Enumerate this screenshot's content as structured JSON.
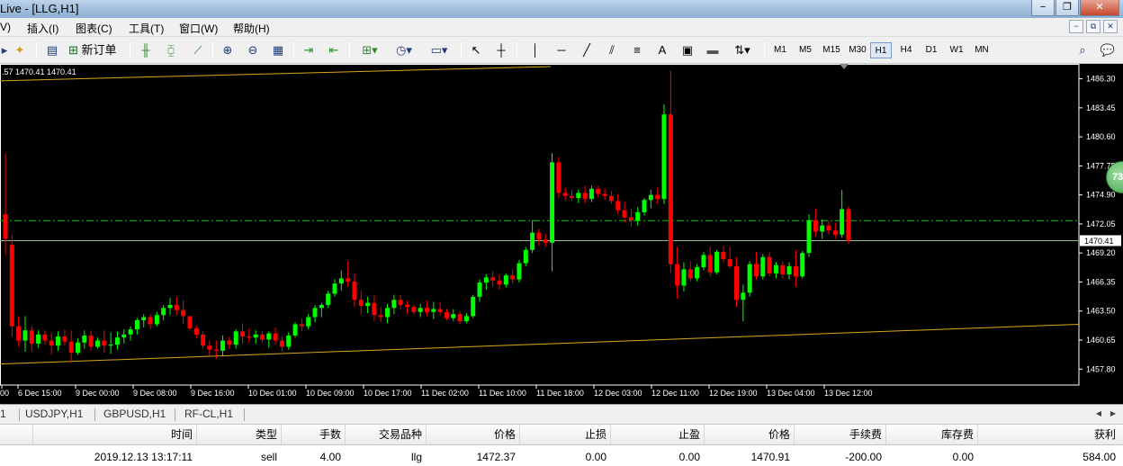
{
  "window": {
    "title": "Live - [LLG,H1]",
    "controls": [
      "−",
      "❐",
      "✕"
    ]
  },
  "menu": {
    "items": [
      "V)",
      "插入(I)",
      "图表(C)",
      "工具(T)",
      "窗口(W)",
      "帮助(H)"
    ],
    "mdi_controls": [
      "−",
      "⧉",
      "✕"
    ]
  },
  "toolbar": {
    "new_order_label": "新订单",
    "text_tool_label": "A",
    "timeframes": [
      "M1",
      "M5",
      "M15",
      "M30",
      "H1",
      "H4",
      "D1",
      "W1",
      "MN"
    ],
    "active_timeframe": "H1"
  },
  "chart": {
    "ohlc_text": ".57 1470.41 1470.41",
    "symbol": "LLG",
    "period": "H1",
    "current_price_label": "1470.41",
    "badge_text": "73",
    "colors": {
      "background": "#000000",
      "bull": "#00ff00",
      "bear": "#ff0000",
      "trendline": "#daa520",
      "price_line": "#8fbc8f",
      "order_line": "#00cc00",
      "axis_text": "#ffffff"
    }
  },
  "chart_data": {
    "type": "candlestick",
    "y_axis_labels": [
      "1486.30",
      "1483.45",
      "1480.60",
      "1477.75",
      "1474.90",
      "1472.05",
      "1469.20",
      "1466.35",
      "1463.50",
      "1460.65",
      "1457.80"
    ],
    "x_axis_labels": [
      "00",
      "6 Dec 15:00",
      "9 Dec 00:00",
      "9 Dec 08:00",
      "9 Dec 16:00",
      "10 Dec 01:00",
      "10 Dec 09:00",
      "10 Dec 17:00",
      "11 Dec 02:00",
      "11 Dec 10:00",
      "11 Dec 18:00",
      "12 Dec 03:00",
      "12 Dec 11:00",
      "12 Dec 19:00",
      "13 Dec 04:00",
      "13 Dec 12:00"
    ],
    "ylim": [
      1456.5,
      1487.5
    ],
    "current_price": 1470.41,
    "order_price": 1472.37,
    "candles": [
      [
        1473,
        1479,
        1469,
        1470.6
      ],
      [
        1470,
        1471,
        1461,
        1462
      ],
      [
        1462,
        1463,
        1460,
        1460.6
      ],
      [
        1460.6,
        1463,
        1459.5,
        1461.6
      ],
      [
        1461.6,
        1462,
        1459.5,
        1460.3
      ],
      [
        1460.3,
        1461.6,
        1459.9,
        1461.2
      ],
      [
        1461.2,
        1461.6,
        1460.2,
        1460.6
      ],
      [
        1460.6,
        1461.4,
        1459.2,
        1460.1
      ],
      [
        1460.1,
        1461.5,
        1459.6,
        1461
      ],
      [
        1461,
        1461.7,
        1460.1,
        1460.5
      ],
      [
        1460.5,
        1461.6,
        1458.4,
        1459.4
      ],
      [
        1459.4,
        1460.8,
        1459.2,
        1460.4
      ],
      [
        1460.4,
        1461.6,
        1459.8,
        1461.1
      ],
      [
        1461.1,
        1461.6,
        1459.6,
        1460
      ],
      [
        1460,
        1460.9,
        1459.8,
        1460.6
      ],
      [
        1460.6,
        1461.6,
        1459.4,
        1460.1
      ],
      [
        1460.1,
        1461.4,
        1459.3,
        1460.2
      ],
      [
        1460.2,
        1461.5,
        1459.7,
        1460.9
      ],
      [
        1460.9,
        1461.7,
        1460.3,
        1461.2
      ],
      [
        1461.2,
        1462,
        1460.6,
        1461.7
      ],
      [
        1461.7,
        1462.8,
        1461.2,
        1462.6
      ],
      [
        1462.6,
        1463.2,
        1461.9,
        1462.9
      ],
      [
        1462.9,
        1463.2,
        1461.7,
        1462.2
      ],
      [
        1462.2,
        1463.4,
        1462,
        1463.1
      ],
      [
        1463.1,
        1464.1,
        1462.6,
        1463.8
      ],
      [
        1463.8,
        1464.8,
        1463.1,
        1464.1
      ],
      [
        1464.1,
        1464.9,
        1463.1,
        1463.6
      ],
      [
        1463.6,
        1464.6,
        1462.2,
        1463
      ],
      [
        1463,
        1462.8,
        1461.7,
        1461.8
      ],
      [
        1461.8,
        1462.1,
        1460.8,
        1461.2
      ],
      [
        1461.2,
        1461.5,
        1459.8,
        1460.1
      ],
      [
        1460.1,
        1460.6,
        1459.1,
        1459.7
      ],
      [
        1459.7,
        1460.6,
        1458.8,
        1459.6
      ],
      [
        1459.6,
        1461.1,
        1459.1,
        1460.6
      ],
      [
        1460.6,
        1461,
        1459.8,
        1460.2
      ],
      [
        1460.2,
        1461.7,
        1459.8,
        1461.5
      ],
      [
        1461.5,
        1462.3,
        1460.3,
        1461
      ],
      [
        1461,
        1461.8,
        1460.4,
        1460.9
      ],
      [
        1460.9,
        1461.6,
        1460.3,
        1461.2
      ],
      [
        1461.2,
        1461.5,
        1460.4,
        1460.7
      ],
      [
        1460.7,
        1461.5,
        1459.9,
        1461.3
      ],
      [
        1461.3,
        1461.9,
        1460.2,
        1460.6
      ],
      [
        1460.6,
        1461,
        1459.5,
        1460
      ],
      [
        1460,
        1461.4,
        1459.7,
        1461.1
      ],
      [
        1461.1,
        1462.4,
        1460.9,
        1462.2
      ],
      [
        1462.2,
        1462.8,
        1461.5,
        1462
      ],
      [
        1462,
        1463.2,
        1461.7,
        1462.9
      ],
      [
        1462.9,
        1464.1,
        1462.4,
        1463.8
      ],
      [
        1463.8,
        1464.3,
        1462.9,
        1464.1
      ],
      [
        1464.1,
        1465.5,
        1463.8,
        1465.2
      ],
      [
        1465.2,
        1466.6,
        1464.9,
        1466.2
      ],
      [
        1466.2,
        1467.5,
        1465.5,
        1466.7
      ],
      [
        1466.7,
        1468.4,
        1465.9,
        1466.4
      ],
      [
        1466.4,
        1467.2,
        1463.9,
        1464.6
      ],
      [
        1464.6,
        1465.5,
        1463.2,
        1464
      ],
      [
        1464,
        1464.9,
        1463.3,
        1464.3
      ],
      [
        1464.3,
        1465.1,
        1462.5,
        1463.1
      ],
      [
        1463.1,
        1463.9,
        1462.4,
        1462.9
      ],
      [
        1462.9,
        1464.2,
        1462.3,
        1463.8
      ],
      [
        1463.8,
        1465.1,
        1463.2,
        1464.6
      ],
      [
        1464.6,
        1465.1,
        1463.6,
        1464.1
      ],
      [
        1464.1,
        1464.5,
        1463.2,
        1463.9
      ],
      [
        1463.9,
        1464.1,
        1463.2,
        1463.4
      ],
      [
        1463.4,
        1464.2,
        1462.9,
        1463.8
      ],
      [
        1463.8,
        1464.5,
        1463,
        1463.4
      ],
      [
        1463.4,
        1464.4,
        1462.7,
        1463.7
      ],
      [
        1463.7,
        1464.4,
        1463.1,
        1463.4
      ],
      [
        1463.4,
        1463.7,
        1462.6,
        1462.8
      ],
      [
        1462.8,
        1463.7,
        1462.5,
        1463.2
      ],
      [
        1463.2,
        1463.5,
        1462.2,
        1462.5
      ],
      [
        1462.5,
        1463.3,
        1462.3,
        1463
      ],
      [
        1463,
        1465.1,
        1462.8,
        1464.9
      ],
      [
        1464.9,
        1466.6,
        1464.4,
        1466.3
      ],
      [
        1466.3,
        1467.1,
        1465.6,
        1466.8
      ],
      [
        1466.8,
        1467.4,
        1465.9,
        1466.5
      ],
      [
        1466.5,
        1467.1,
        1465.6,
        1466.1
      ],
      [
        1466.1,
        1467.2,
        1465.8,
        1467
      ],
      [
        1467,
        1467.6,
        1466.2,
        1466.6
      ],
      [
        1466.6,
        1468.5,
        1466.3,
        1468.2
      ],
      [
        1468.2,
        1469.8,
        1467.9,
        1469.5
      ],
      [
        1469.5,
        1472.4,
        1469.2,
        1471.2
      ],
      [
        1471.2,
        1471.6,
        1469.9,
        1470.5
      ],
      [
        1470.5,
        1471.1,
        1469.8,
        1470.2
      ],
      [
        1470.2,
        1479,
        1467.4,
        1478.1
      ],
      [
        1478.1,
        1478.6,
        1474.6,
        1475.1
      ],
      [
        1475.1,
        1475.6,
        1474.4,
        1474.8
      ],
      [
        1474.8,
        1475.4,
        1474.3,
        1474.6
      ],
      [
        1474.6,
        1475.4,
        1474.1,
        1475.1
      ],
      [
        1475.1,
        1475.8,
        1474.1,
        1474.5
      ],
      [
        1474.5,
        1475.8,
        1474.2,
        1475.5
      ],
      [
        1475.5,
        1475.8,
        1474.7,
        1475
      ],
      [
        1475,
        1475.5,
        1474.4,
        1474.8
      ],
      [
        1474.8,
        1475.3,
        1474,
        1474.3
      ],
      [
        1474.3,
        1475,
        1473,
        1473.4
      ],
      [
        1473.4,
        1474.2,
        1472.2,
        1472.7
      ],
      [
        1472.7,
        1473.6,
        1471.8,
        1472.4
      ],
      [
        1472.4,
        1473.7,
        1471.9,
        1473.2
      ],
      [
        1473.2,
        1474.6,
        1472.9,
        1474.4
      ],
      [
        1474.4,
        1475.4,
        1473.6,
        1474.9
      ],
      [
        1474.9,
        1475.6,
        1474,
        1474.5
      ],
      [
        1474.5,
        1483.8,
        1474,
        1482.8
      ],
      [
        1482.8,
        1487.1,
        1467.3,
        1468.1
      ],
      [
        1468.1,
        1469.8,
        1464.7,
        1466
      ],
      [
        1466,
        1468.3,
        1465.4,
        1467.6
      ],
      [
        1467.6,
        1468.4,
        1466.4,
        1466.7
      ],
      [
        1466.7,
        1468.1,
        1466.4,
        1467.8
      ],
      [
        1467.8,
        1469.3,
        1467.5,
        1469
      ],
      [
        1469,
        1469.8,
        1466.9,
        1467.3
      ],
      [
        1467.3,
        1469.5,
        1467.1,
        1469.3
      ],
      [
        1469.3,
        1469.9,
        1468.2,
        1468.6
      ],
      [
        1468.6,
        1469.8,
        1467.7,
        1467.9
      ],
      [
        1467.9,
        1468.8,
        1463.9,
        1464.6
      ],
      [
        1464.6,
        1466.1,
        1462.5,
        1465.3
      ],
      [
        1465.3,
        1468.4,
        1464.9,
        1468.1
      ],
      [
        1468.1,
        1469.3,
        1466.6,
        1466.9
      ],
      [
        1466.9,
        1469.1,
        1466.6,
        1468.8
      ],
      [
        1468.8,
        1469.3,
        1466.9,
        1467.2
      ],
      [
        1467.2,
        1468.3,
        1466.7,
        1468
      ],
      [
        1468,
        1468.4,
        1466.7,
        1467.1
      ],
      [
        1467.1,
        1468.3,
        1466.6,
        1467.9
      ],
      [
        1467.9,
        1469.5,
        1465.9,
        1466.9
      ],
      [
        1466.9,
        1469.4,
        1466.7,
        1469.2
      ],
      [
        1469.2,
        1473,
        1468.8,
        1472.4
      ],
      [
        1472.4,
        1473.6,
        1470.8,
        1471.3
      ],
      [
        1471.3,
        1472.5,
        1470.6,
        1471.9
      ],
      [
        1471.9,
        1472.4,
        1471,
        1471.4
      ],
      [
        1471.4,
        1472.2,
        1470.6,
        1471
      ],
      [
        1471,
        1475.4,
        1470.7,
        1473.5
      ],
      [
        1473.5,
        1473.8,
        1470.1,
        1470.41
      ]
    ]
  },
  "symbol_tabs": [
    "1",
    "USDJPY,H1",
    "GBPUSD,H1",
    "RF-CL,H1"
  ],
  "trade": {
    "headers": [
      "时间",
      "类型",
      "手数",
      "交易品种",
      "价格",
      "止损",
      "止盈",
      "价格",
      "手续费",
      "库存费",
      "获利"
    ],
    "row": [
      "2019.12.13 13:17:11",
      "sell",
      "4.00",
      "llg",
      "1472.37",
      "0.00",
      "0.00",
      "1470.91",
      "-200.00",
      "0.00",
      "584.00"
    ]
  }
}
